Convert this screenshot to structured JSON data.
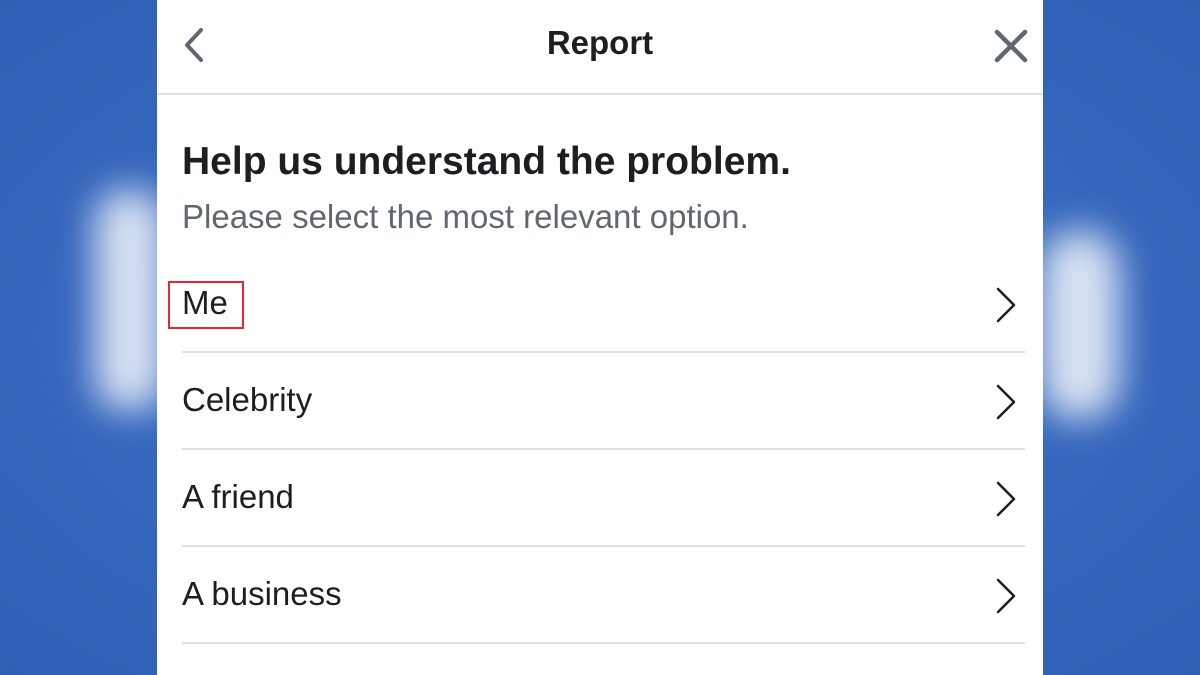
{
  "header": {
    "title": "Report",
    "back_icon": "chevron-left-icon",
    "close_icon": "close-icon"
  },
  "content": {
    "heading": "Help us understand the problem.",
    "subheading": "Please select the most relevant option."
  },
  "options": [
    {
      "label": "Me",
      "icon": "chevron-right-icon",
      "highlighted": true
    },
    {
      "label": "Celebrity",
      "icon": "chevron-right-icon"
    },
    {
      "label": "A friend",
      "icon": "chevron-right-icon"
    },
    {
      "label": "A business",
      "icon": "chevron-right-icon"
    }
  ],
  "colors": {
    "background": "#3a6fc4",
    "panel": "#ffffff",
    "text_primary": "#1c1e21",
    "text_secondary": "#606770",
    "divider": "#dddfe2",
    "highlight_border": "#e8262e"
  }
}
